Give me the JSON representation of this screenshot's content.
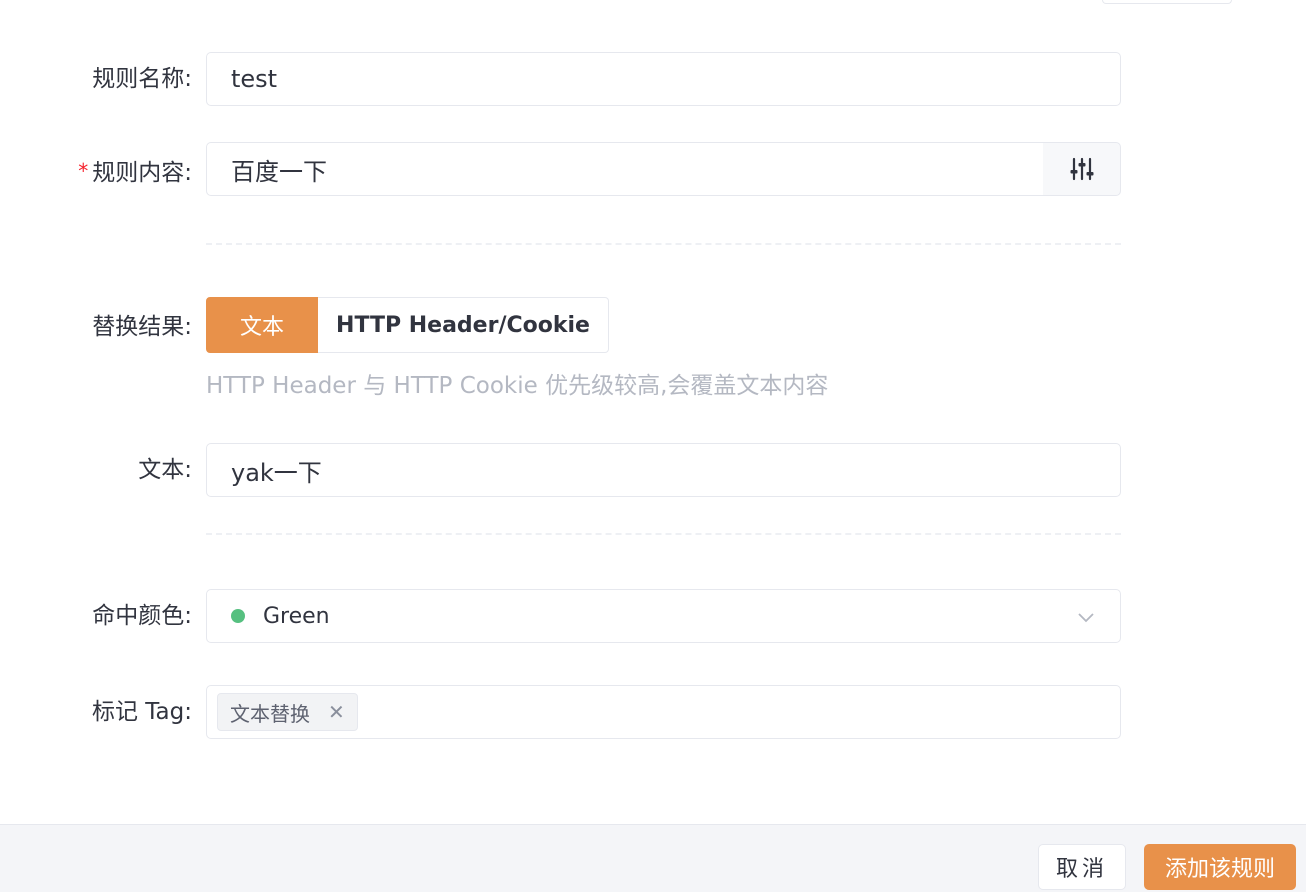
{
  "form": {
    "rule_name": {
      "label": "规则名称:",
      "value": "test"
    },
    "rule_content": {
      "label": "规则内容:",
      "required_mark": "*",
      "value": "百度一下",
      "addon_icon": "adjust-sliders-icon"
    },
    "replace_result": {
      "label": "替换结果:",
      "options": [
        "文本",
        "HTTP Header/Cookie"
      ],
      "selected": "文本",
      "hint": "HTTP Header 与 HTTP Cookie 优先级较高,会覆盖文本内容"
    },
    "text": {
      "label": "文本:",
      "value": "yak一下"
    },
    "hit_color": {
      "label": "命中颜色:",
      "value": "Green",
      "dot_color": "#56c080",
      "icon": "chevron-down-icon"
    },
    "mark_tag": {
      "label": "标记 Tag:",
      "tags": [
        "文本替换"
      ]
    }
  },
  "footer": {
    "cancel_label": "取消",
    "submit_label": "添加该规则"
  },
  "colors": {
    "accent": "#e8914a",
    "required": "#f5222d"
  }
}
